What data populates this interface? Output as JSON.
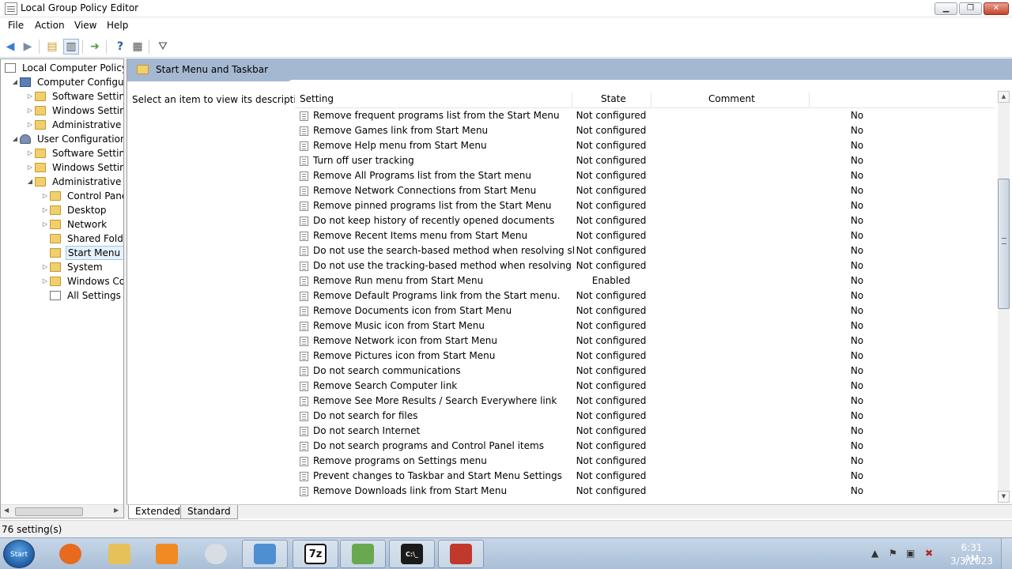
{
  "window": {
    "title": "Local Group Policy Editor",
    "controls": {
      "minimize": "▁",
      "maximize": "❐",
      "close": "✕"
    }
  },
  "menu": [
    "File",
    "Action",
    "View",
    "Help"
  ],
  "tree": {
    "root": "Local Computer Policy",
    "computer_config": "Computer Configura",
    "software_settings_1": "Software Settings",
    "windows_settings_1": "Windows Setting",
    "admin_templates_1": "Administrative Te",
    "user_config": "User Configuration",
    "software_settings_2": "Software Settings",
    "windows_settings_2": "Windows Setting",
    "admin_templates_2": "Administrative Te",
    "control_panel": "Control Panel",
    "desktop": "Desktop",
    "network": "Network",
    "shared_folders": "Shared Folder",
    "start_menu": "Start Menu ar",
    "system": "System",
    "windows_components": "Windows Cor",
    "all_settings": "All Settings"
  },
  "main": {
    "title": "Start Menu and Taskbar",
    "description": "Select an item to view its description."
  },
  "columns": {
    "setting": "Setting",
    "state": "State",
    "comment": "Comment"
  },
  "rows": [
    {
      "setting": "Remove frequent programs list from the Start Menu",
      "state": "Not configured",
      "comment": "No"
    },
    {
      "setting": "Remove Games link from Start Menu",
      "state": "Not configured",
      "comment": "No"
    },
    {
      "setting": "Remove Help menu from Start Menu",
      "state": "Not configured",
      "comment": "No"
    },
    {
      "setting": "Turn off user tracking",
      "state": "Not configured",
      "comment": "No"
    },
    {
      "setting": "Remove All Programs list from the Start menu",
      "state": "Not configured",
      "comment": "No"
    },
    {
      "setting": "Remove Network Connections from Start Menu",
      "state": "Not configured",
      "comment": "No"
    },
    {
      "setting": "Remove pinned programs list from the Start Menu",
      "state": "Not configured",
      "comment": "No"
    },
    {
      "setting": "Do not keep history of recently opened documents",
      "state": "Not configured",
      "comment": "No"
    },
    {
      "setting": "Remove Recent Items menu from Start Menu",
      "state": "Not configured",
      "comment": "No"
    },
    {
      "setting": "Do not use the search-based method when resolving shell s...",
      "state": "Not configured",
      "comment": "No"
    },
    {
      "setting": "Do not use the tracking-based method when resolving shell ...",
      "state": "Not configured",
      "comment": "No"
    },
    {
      "setting": "Remove Run menu from Start Menu",
      "state": "Enabled",
      "comment": "No"
    },
    {
      "setting": "Remove Default Programs link from the Start menu.",
      "state": "Not configured",
      "comment": "No"
    },
    {
      "setting": "Remove Documents icon from Start Menu",
      "state": "Not configured",
      "comment": "No"
    },
    {
      "setting": "Remove Music icon from Start Menu",
      "state": "Not configured",
      "comment": "No"
    },
    {
      "setting": "Remove Network icon from Start Menu",
      "state": "Not configured",
      "comment": "No"
    },
    {
      "setting": "Remove Pictures icon from Start Menu",
      "state": "Not configured",
      "comment": "No"
    },
    {
      "setting": "Do not search communications",
      "state": "Not configured",
      "comment": "No"
    },
    {
      "setting": "Remove Search Computer link",
      "state": "Not configured",
      "comment": "No"
    },
    {
      "setting": "Remove See More Results / Search Everywhere link",
      "state": "Not configured",
      "comment": "No"
    },
    {
      "setting": "Do not search for files",
      "state": "Not configured",
      "comment": "No"
    },
    {
      "setting": "Do not search Internet",
      "state": "Not configured",
      "comment": "No"
    },
    {
      "setting": "Do not search programs and Control Panel items",
      "state": "Not configured",
      "comment": "No"
    },
    {
      "setting": "Remove programs on Settings menu",
      "state": "Not configured",
      "comment": "No"
    },
    {
      "setting": "Prevent changes to Taskbar and Start Menu Settings",
      "state": "Not configured",
      "comment": "No"
    },
    {
      "setting": "Remove Downloads link from Start Menu",
      "state": "Not configured",
      "comment": "No"
    }
  ],
  "view_tabs": {
    "extended": "Extended",
    "standard": "Standard"
  },
  "status": "76 setting(s)",
  "taskbar": {
    "start": "Start",
    "apps": [
      {
        "name": "firefox-icon",
        "label": "",
        "color": "#e86a1f"
      },
      {
        "name": "explorer-icon",
        "label": "",
        "color": "#e6c15a"
      },
      {
        "name": "media-player-icon",
        "label": "",
        "color": "#f08a24"
      },
      {
        "name": "disc-icon",
        "label": "",
        "color": "#d8dde4"
      },
      {
        "name": "mail-icon",
        "label": "",
        "color": "#4e8fd1"
      },
      {
        "name": "7zip-icon",
        "label": "7z",
        "color": "#111111"
      },
      {
        "name": "users-icon",
        "label": "",
        "color": "#6aa84f"
      },
      {
        "name": "cmd-icon",
        "label": "C:\\_",
        "color": "#1a1a1a"
      },
      {
        "name": "toolbox-icon",
        "label": "",
        "color": "#c0392b"
      }
    ],
    "clock_time": "6:31 AM",
    "clock_date": "3/3/2023"
  }
}
